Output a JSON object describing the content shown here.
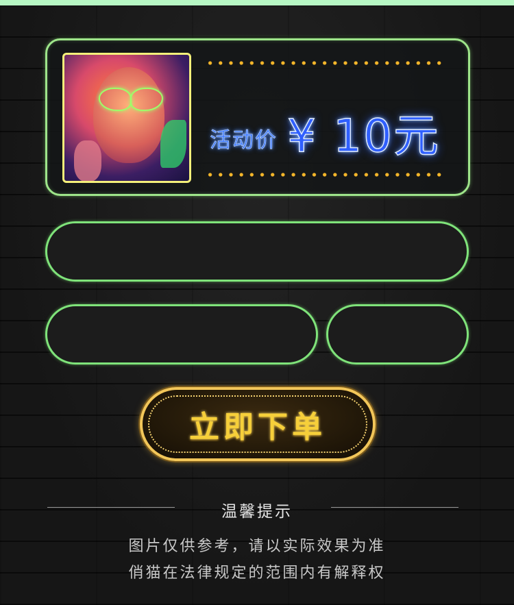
{
  "product": {
    "price_label": "活动价",
    "price_value": "¥ 10元",
    "image_icon": "neon-makeup-portrait-image",
    "colors": {
      "card_border": "#9ee58a",
      "thumb_border": "#f5f07a",
      "dots": "#f4b62a",
      "price_blue": "#2f5fff"
    }
  },
  "form": {
    "field_full": "",
    "field_left": "",
    "field_right": "",
    "field_border_color": "#7fe37a"
  },
  "order": {
    "button_label": "立即下单",
    "button_color": "#f6cf3a"
  },
  "tips": {
    "title": "温馨提示",
    "line1": "图片仅供参考，请以实际效果为准",
    "line2": "俏猫在法律规定的范围内有解释权"
  }
}
